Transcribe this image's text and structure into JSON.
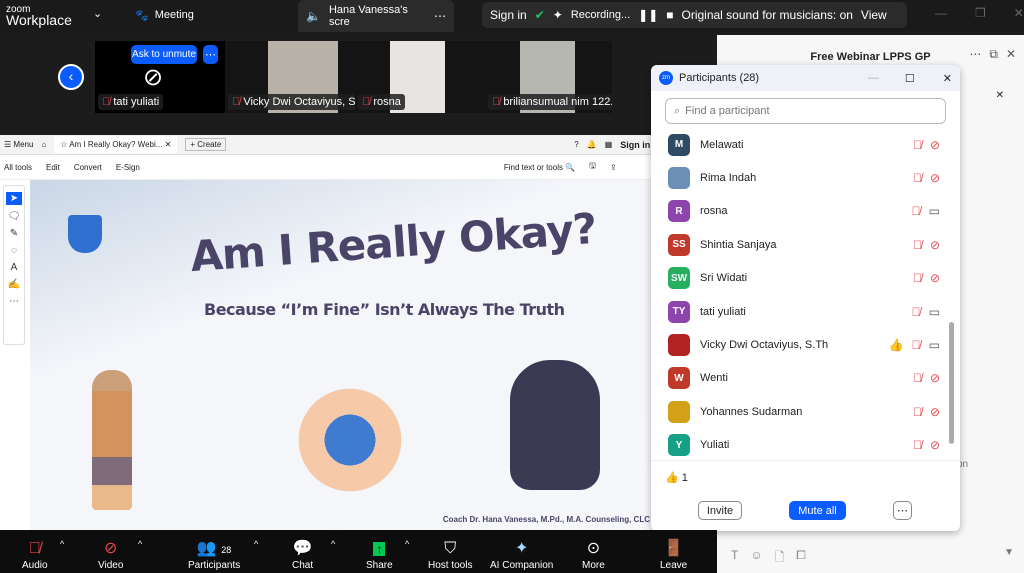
{
  "topbar": {
    "brand_small": "zoom",
    "brand": "Workplace",
    "meeting_label": "Meeting",
    "share_tab": "Hana Vanessa's scre",
    "sign_in": "Sign in",
    "recording": "Recording...",
    "sound": "Original sound for musicians: on",
    "view": "View"
  },
  "videos": [
    {
      "name": "tati yuliati",
      "ask_unmute": "Ask to unmute"
    },
    {
      "name": "Vicky Dwi Octaviyus, S..."
    },
    {
      "name": "rosna"
    },
    {
      "name": "briliansumual nim 122..."
    }
  ],
  "acrobat": {
    "menu": "Menu",
    "tab_title": "Am I Really Okay? Webi...",
    "create": "Create",
    "sign_in": "Sign in",
    "tools": [
      "All tools",
      "Edit",
      "Convert",
      "E-Sign"
    ],
    "find": "Find text or tools"
  },
  "slide": {
    "title": "Am I Really Okay?",
    "subtitle": "Because “I’m Fine” Isn’t Always The Truth",
    "credit": "Coach Dr. Hana Vanessa, M.Pd., M.A. Counseling, CLC"
  },
  "chat": {
    "title": "Free Webinar LPPS GP",
    "partial": "on"
  },
  "participants": {
    "title": "Participants (28)",
    "search_placeholder": "Find a participant",
    "list": [
      {
        "initials": "M",
        "name": "Melawati",
        "color": "#2f4a63",
        "video_off": true,
        "reaction": ""
      },
      {
        "initials": "",
        "name": "Rima Indah",
        "color": "#6b8fb5",
        "video_off": true,
        "reaction": ""
      },
      {
        "initials": "R",
        "name": "rosna",
        "color": "#8e44ad",
        "video_off": false,
        "reaction": ""
      },
      {
        "initials": "SS",
        "name": "Shintia Sanjaya",
        "color": "#c0392b",
        "video_off": true,
        "reaction": ""
      },
      {
        "initials": "SW",
        "name": "Sri Widati",
        "color": "#27ae60",
        "video_off": true,
        "reaction": ""
      },
      {
        "initials": "TY",
        "name": "tati yuliati",
        "color": "#8e44ad",
        "video_off": false,
        "reaction": ""
      },
      {
        "initials": "",
        "name": "Vicky Dwi Octaviyus, S.Th",
        "color": "#b22222",
        "video_off": false,
        "reaction": "👍"
      },
      {
        "initials": "W",
        "name": "Wenti",
        "color": "#c0392b",
        "video_off": true,
        "reaction": ""
      },
      {
        "initials": "",
        "name": "Yohannes Sudarman",
        "color": "#d4a017",
        "video_off": true,
        "reaction": ""
      },
      {
        "initials": "Y",
        "name": "Yuliati",
        "color": "#16a085",
        "video_off": true,
        "reaction": ""
      }
    ],
    "reaction_count": "1",
    "invite": "Invite",
    "mute_all": "Mute all"
  },
  "toolbar": {
    "audio": "Audio",
    "video": "Video",
    "participants": "Participants",
    "participants_count": "28",
    "chat": "Chat",
    "share": "Share",
    "host_tools": "Host tools",
    "ai": "AI Companion",
    "more": "More",
    "leave": "Leave"
  },
  "colors": {
    "accent": "#0b5cff",
    "muted": "#e5484d",
    "share": "#00c853"
  }
}
